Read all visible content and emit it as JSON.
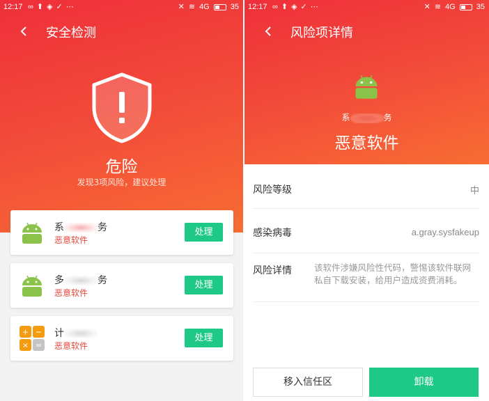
{
  "status_bar": {
    "left_time": "12:17",
    "right_time": "12:17",
    "signal_label": "4G",
    "battery": "35"
  },
  "scan_screen": {
    "title": "安全检测",
    "status": "危险",
    "summary": "发现3项风险，建议处理",
    "items": [
      {
        "name_start": "系",
        "name_end": "务",
        "tag": "恶意软件",
        "action": "处理",
        "icon": "android-icon"
      },
      {
        "name_start": "多",
        "name_end": "务",
        "tag": "恶意软件",
        "action": "处理",
        "icon": "android-icon"
      },
      {
        "name_start": "计",
        "name_end": "",
        "tag": "恶意软件",
        "action": "处理",
        "icon": "calculator-icon"
      }
    ]
  },
  "detail_screen": {
    "title": "风险项详情",
    "app_name_start": "系",
    "app_name_end": "务",
    "risk_type": "恶意软件",
    "rows": {
      "level_label": "风险等级",
      "level_value": "中",
      "virus_label": "感染病毒",
      "virus_value": "a.gray.sysfakeup",
      "details_label": "风险详情",
      "details_value": "该软件涉嫌风险性代码，警惕该软件联网私自下载安装，给用户造成资费消耗。"
    },
    "trust_button": "移入信任区",
    "uninstall_button": "卸载"
  },
  "colors": {
    "hero_red": "#ef2f3a",
    "hero_orange": "#f76d33",
    "action_green": "#1ec987",
    "danger_text": "#e8453c",
    "android_green": "#8bc34a"
  }
}
